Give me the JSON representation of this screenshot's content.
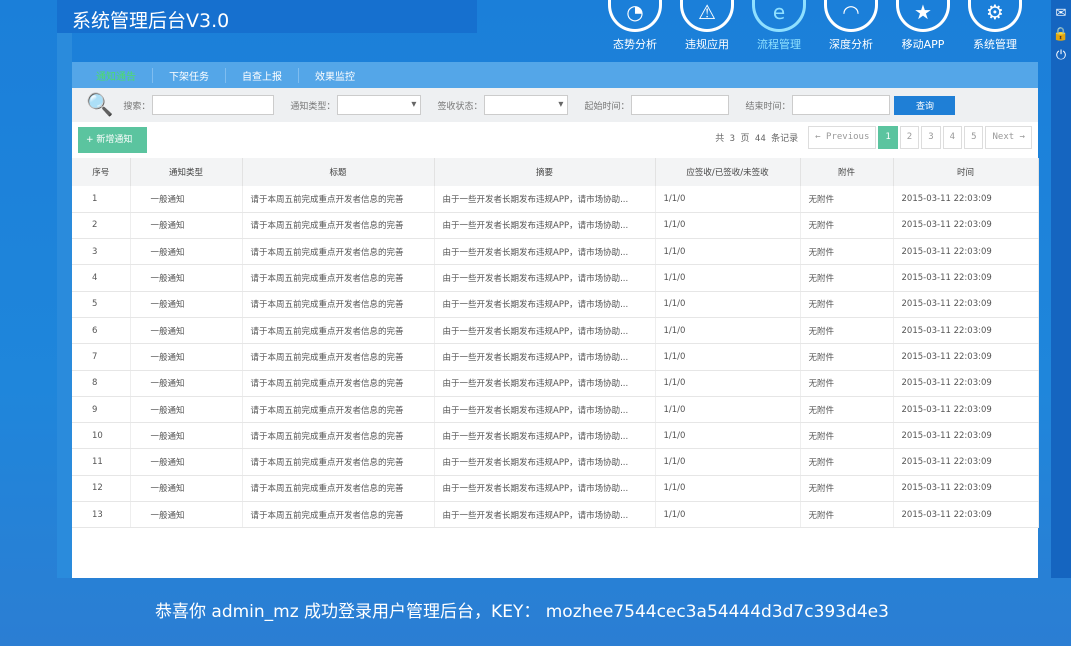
{
  "app": {
    "title": "系统管理后台V3.0"
  },
  "nav": [
    {
      "label": "态势分析",
      "icon": "pie-chart-icon"
    },
    {
      "label": "违规应用",
      "icon": "warning-icon"
    },
    {
      "label": "流程管理",
      "icon": "ie-icon",
      "active": true
    },
    {
      "label": "深度分析",
      "icon": "gauge-icon"
    },
    {
      "label": "移动APP",
      "icon": "location-star-icon"
    },
    {
      "label": "系统管理",
      "icon": "gear-icon"
    }
  ],
  "side_icons": [
    "mail-icon",
    "lock-icon",
    "power-icon"
  ],
  "tabs": [
    {
      "label": "通知通告",
      "active": true
    },
    {
      "label": "下架任务"
    },
    {
      "label": "自查上报"
    },
    {
      "label": "效果监控"
    }
  ],
  "search": {
    "search_label": "搜索：",
    "type_label": "通知类型：",
    "status_label": "签收状态：",
    "start_label": "起始时间：",
    "end_label": "结束时间：",
    "query": "查询"
  },
  "toolbar": {
    "add": "+ 新增通知",
    "info": "共 3 页 44 条记录",
    "prev": "← Previous",
    "pages": [
      "1",
      "2",
      "3",
      "4",
      "5"
    ],
    "current_page": 1,
    "next": "Next →"
  },
  "table": {
    "headers": [
      "序号",
      "通知类型",
      "标题",
      "摘要",
      "应签收/已签收/未签收",
      "附件",
      "时间"
    ],
    "rows": [
      [
        "1",
        "一般通知",
        "请于本周五前完成重点开发者信息的完善",
        "由于一些开发者长期发布违规APP，请市场协助...",
        "1/1/0",
        "无附件",
        "2015-03-11 22:03:09"
      ],
      [
        "2",
        "一般通知",
        "请于本周五前完成重点开发者信息的完善",
        "由于一些开发者长期发布违规APP，请市场协助...",
        "1/1/0",
        "无附件",
        "2015-03-11 22:03:09"
      ],
      [
        "3",
        "一般通知",
        "请于本周五前完成重点开发者信息的完善",
        "由于一些开发者长期发布违规APP，请市场协助...",
        "1/1/0",
        "无附件",
        "2015-03-11 22:03:09"
      ],
      [
        "4",
        "一般通知",
        "请于本周五前完成重点开发者信息的完善",
        "由于一些开发者长期发布违规APP，请市场协助...",
        "1/1/0",
        "无附件",
        "2015-03-11 22:03:09"
      ],
      [
        "5",
        "一般通知",
        "请于本周五前完成重点开发者信息的完善",
        "由于一些开发者长期发布违规APP，请市场协助...",
        "1/1/0",
        "无附件",
        "2015-03-11 22:03:09"
      ],
      [
        "6",
        "一般通知",
        "请于本周五前完成重点开发者信息的完善",
        "由于一些开发者长期发布违规APP，请市场协助...",
        "1/1/0",
        "无附件",
        "2015-03-11 22:03:09"
      ],
      [
        "7",
        "一般通知",
        "请于本周五前完成重点开发者信息的完善",
        "由于一些开发者长期发布违规APP，请市场协助...",
        "1/1/0",
        "无附件",
        "2015-03-11 22:03:09"
      ],
      [
        "8",
        "一般通知",
        "请于本周五前完成重点开发者信息的完善",
        "由于一些开发者长期发布违规APP，请市场协助...",
        "1/1/0",
        "无附件",
        "2015-03-11 22:03:09"
      ],
      [
        "9",
        "一般通知",
        "请于本周五前完成重点开发者信息的完善",
        "由于一些开发者长期发布违规APP，请市场协助...",
        "1/1/0",
        "无附件",
        "2015-03-11 22:03:09"
      ],
      [
        "10",
        "一般通知",
        "请于本周五前完成重点开发者信息的完善",
        "由于一些开发者长期发布违规APP，请市场协助...",
        "1/1/0",
        "无附件",
        "2015-03-11 22:03:09"
      ],
      [
        "11",
        "一般通知",
        "请于本周五前完成重点开发者信息的完善",
        "由于一些开发者长期发布违规APP，请市场协助...",
        "1/1/0",
        "无附件",
        "2015-03-11 22:03:09"
      ],
      [
        "12",
        "一般通知",
        "请于本周五前完成重点开发者信息的完善",
        "由于一些开发者长期发布违规APP，请市场协助...",
        "1/1/0",
        "无附件",
        "2015-03-11 22:03:09"
      ],
      [
        "13",
        "一般通知",
        "请于本周五前完成重点开发者信息的完善",
        "由于一些开发者长期发布违规APP，请市场协助...",
        "1/1/0",
        "无附件",
        "2015-03-11 22:03:09"
      ]
    ]
  },
  "footer": "恭喜你 admin_mz 成功登录用户管理后台，KEY： mozhee7544cec3a54444d3d7c393d4e3"
}
